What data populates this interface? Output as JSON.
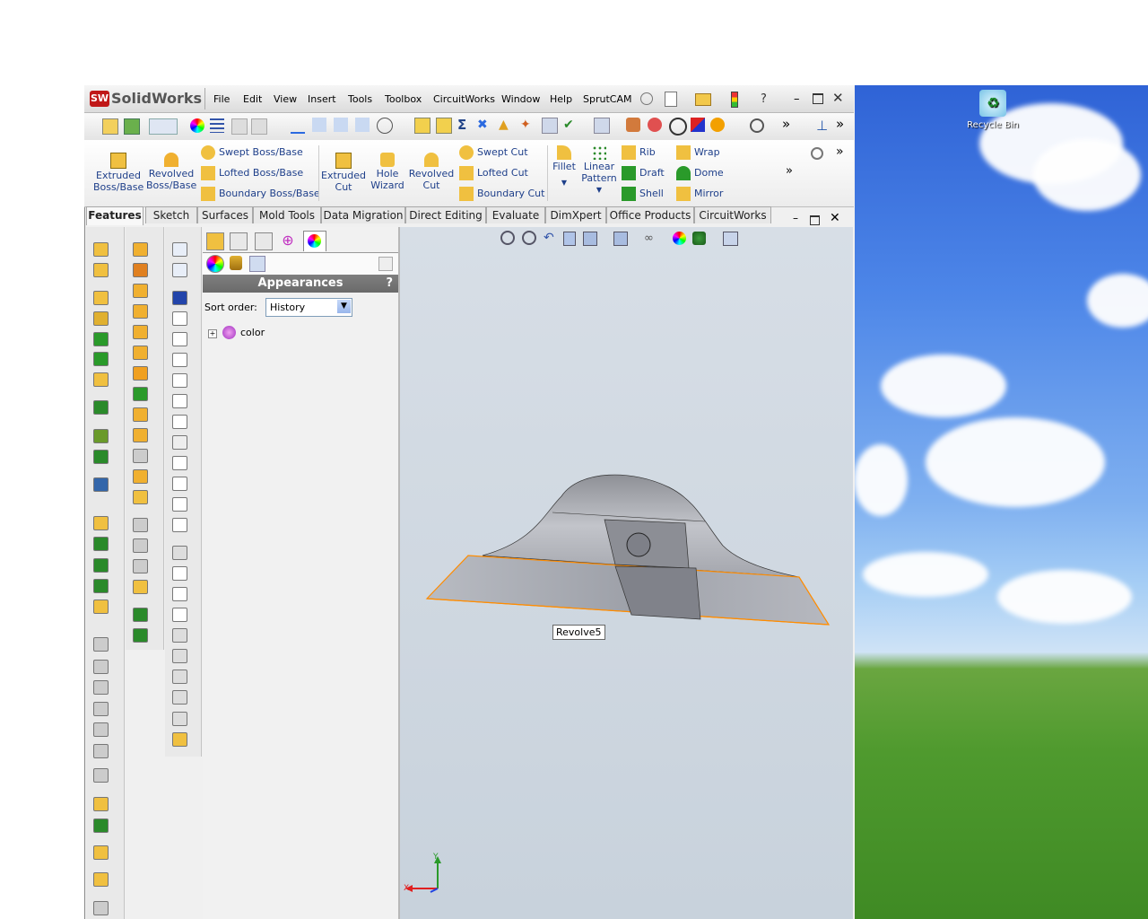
{
  "app": {
    "name": "SolidWorks"
  },
  "menu": [
    "File",
    "Edit",
    "View",
    "Insert",
    "Tools",
    "Toolbox",
    "CircuitWorks",
    "Window",
    "Help",
    "SprutCAM"
  ],
  "command_manager": {
    "big": [
      {
        "label1": "Extruded",
        "label2": "Boss/Base"
      },
      {
        "label1": "Revolved",
        "label2": "Boss/Base"
      },
      {
        "label1": "Extruded",
        "label2": "Cut"
      },
      {
        "label1": "Hole",
        "label2": "Wizard"
      },
      {
        "label1": "Revolved",
        "label2": "Cut"
      },
      {
        "label1": "Fillet",
        "label2": ""
      },
      {
        "label1": "Linear",
        "label2": "Pattern"
      }
    ],
    "boss": [
      "Swept Boss/Base",
      "Lofted Boss/Base",
      "Boundary Boss/Base"
    ],
    "cut": [
      "Swept Cut",
      "Lofted Cut",
      "Boundary Cut"
    ],
    "misc1": [
      "Rib",
      "Draft",
      "Shell"
    ],
    "misc2": [
      "Wrap",
      "Dome",
      "Mirror"
    ]
  },
  "tabs": [
    "Features",
    "Sketch",
    "Surfaces",
    "Mold Tools",
    "Data Migration",
    "Direct Editing",
    "Evaluate",
    "DimXpert",
    "Office Products",
    "CircuitWorks"
  ],
  "panel": {
    "title": "Appearances",
    "help": "?",
    "sort_label": "Sort order:",
    "sort_value": "History",
    "tree_item": "color"
  },
  "viewport": {
    "tooltip": "Revolve5",
    "axis_x": "X",
    "axis_y": "Y"
  },
  "desktop": {
    "recycle_bin": "Recycle Bin"
  },
  "colors": {
    "accent": "#1e3f8a",
    "selection": "#ff8c00",
    "header": "#707070"
  }
}
